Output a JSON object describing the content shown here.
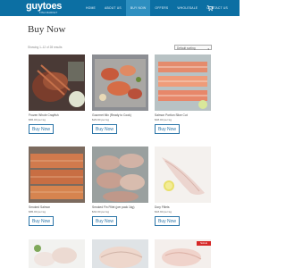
{
  "header": {
    "logo": "guytoes",
    "logo_sub": "FISH MARKET",
    "nav": [
      "HOME",
      "ABOUT US",
      "BUY NOW",
      "OFFERS",
      "WHOLESALE",
      "CONTACT US"
    ],
    "active_nav": "BUY NOW",
    "colors": {
      "bar": "#0c6fa3",
      "active": "#2e8fc0"
    }
  },
  "page": {
    "title": "Buy Now",
    "result_count": "Showing 1–12 of 28 results",
    "sort_value": "Default sorting"
  },
  "products": [
    {
      "name": "Frozen Whole Crayfish",
      "price": "$65.00 per kg",
      "button": "Buy Now"
    },
    {
      "name": "Gourmet Mix (Ready to Cook)",
      "price": "$29.90 per kg",
      "button": "Buy Now"
    },
    {
      "name": "Salmon Portion Slice Cut",
      "price": "$48.00 per kg",
      "button": "Buy Now"
    },
    {
      "name": "Smoked Salmon",
      "price": "$85.00 per kg",
      "button": "Buy Now"
    },
    {
      "name": "Smoked Fin Fillet (per pack 1kg)",
      "price": "$32.00 per kg",
      "button": "Buy Now"
    },
    {
      "name": "Dory Fillets",
      "price": "$18.90 per kg",
      "button": "Buy Now"
    }
  ],
  "badge": "SALE"
}
